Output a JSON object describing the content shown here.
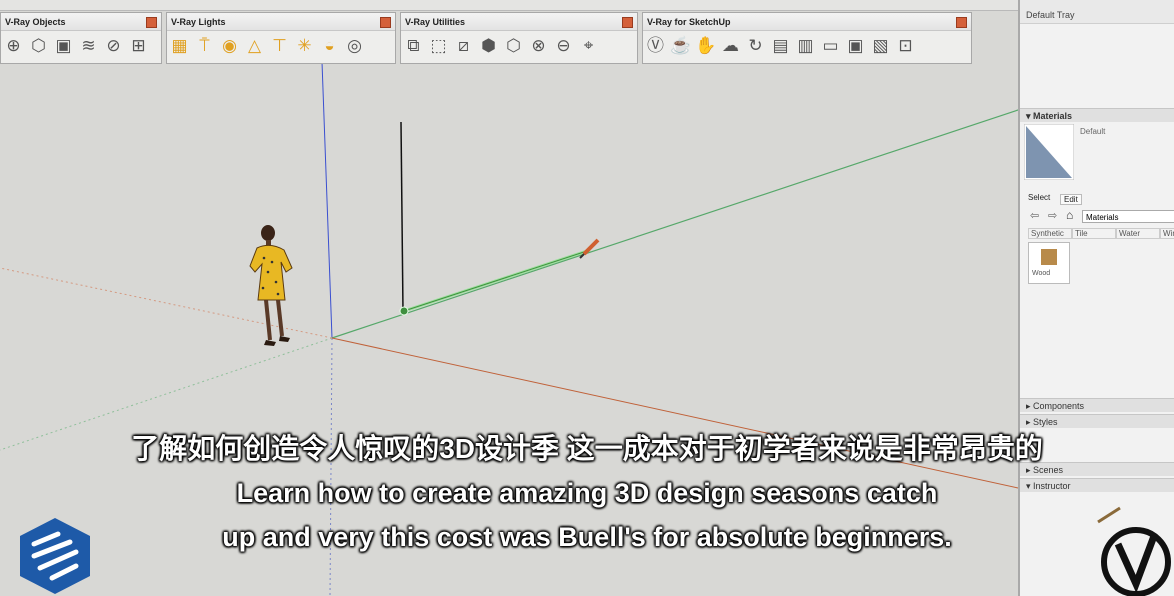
{
  "toolbars": [
    {
      "title": "V-Ray Objects",
      "icons": [
        "sphere-icon",
        "cube-outline-icon",
        "cube-box-icon",
        "fur-icon",
        "mesh-icon",
        "grid-icon"
      ]
    },
    {
      "title": "V-Ray Lights",
      "icons": [
        "rect-light-icon",
        "spot-light-icon",
        "sphere-light-icon",
        "ies-light-icon",
        "omni-light-icon",
        "sun-icon",
        "dome-light-icon",
        "mesh-light-icon"
      ]
    },
    {
      "title": "V-Ray Utilities",
      "icons": [
        "copy-icon",
        "select-icon",
        "slash-icon",
        "box-icon",
        "cube-icon",
        "sphere-a-icon",
        "sphere-b-icon",
        "cursor-icon"
      ]
    },
    {
      "title": "V-Ray for SketchUp",
      "icons": [
        "vray-logo-icon",
        "teapot-icon",
        "interactive-icon",
        "cloud-icon",
        "refresh-icon",
        "frame-buffer-icon",
        "lock-icon",
        "image-icon",
        "camera-icon",
        "settings-icon",
        "lock2-icon"
      ]
    }
  ],
  "tray": {
    "title": "Default Tray",
    "materials": {
      "header": "Materials",
      "default_label": "Default",
      "tabs": [
        "Select",
        "Edit"
      ],
      "library": "Materials",
      "categories": [
        "Synthetic",
        "Tile",
        "Water",
        "Wind"
      ],
      "swatch_label": "Wood"
    },
    "sections": [
      "Components",
      "Styles",
      "Scenes",
      "Instructor"
    ]
  },
  "subtitles": {
    "chinese": "了解如何创造令人惊叹的3D设计季 这一成本对于初学者来说是非常昂贵的",
    "english_line1": "Learn how to create amazing 3D design seasons catch",
    "english_line2": "up and very this cost was Buell's for absolute beginners."
  },
  "colors": {
    "axis_blue": "#3a4fd0",
    "axis_green": "#56a86a",
    "axis_red": "#c0623a",
    "sketchup_blue": "#1e5aa8"
  }
}
